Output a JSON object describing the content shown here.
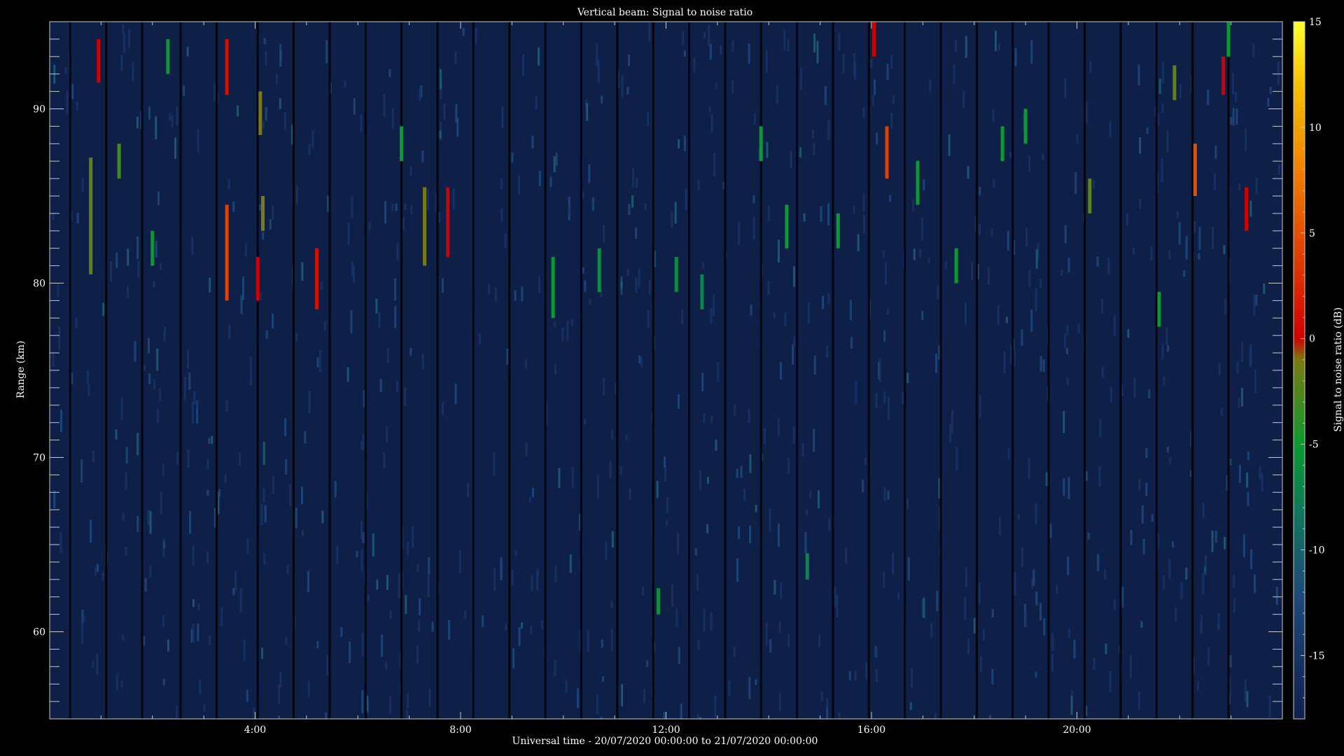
{
  "chart_data": {
    "type": "heatmap",
    "title": "Vertical beam: Signal to noise ratio",
    "xlabel": "Universal time - 20/07/2020 00:00:00 to 21/07/2020 00:00:00",
    "ylabel": "Range (km)",
    "colorbar_label": "Signal to noise ratio (dB)",
    "x_range_hours": [
      0,
      24
    ],
    "y_range_km": [
      55,
      95
    ],
    "color_range_db": [
      -18,
      15
    ],
    "background_color": "#0e1f48",
    "x_ticks": [
      {
        "value": 4,
        "label": "4:00"
      },
      {
        "value": 8,
        "label": "8:00"
      },
      {
        "value": 12,
        "label": "12:00"
      },
      {
        "value": 16,
        "label": "16:00"
      },
      {
        "value": 20,
        "label": "20:00"
      }
    ],
    "y_ticks": [
      {
        "value": 60,
        "label": "60"
      },
      {
        "value": 70,
        "label": "70"
      },
      {
        "value": 80,
        "label": "80"
      },
      {
        "value": 90,
        "label": "90"
      }
    ],
    "colorbar_ticks": [
      {
        "value": 15,
        "label": "15"
      },
      {
        "value": 10,
        "label": "10"
      },
      {
        "value": 5,
        "label": "5"
      },
      {
        "value": 0,
        "label": "0"
      },
      {
        "value": -5,
        "label": "-5"
      },
      {
        "value": -10,
        "label": "-10"
      },
      {
        "value": -15,
        "label": "-15"
      }
    ],
    "colormap": [
      {
        "db": -18,
        "color": "#10204e"
      },
      {
        "db": -12,
        "color": "#1e4a78"
      },
      {
        "db": -8,
        "color": "#0f7a5a"
      },
      {
        "db": -5,
        "color": "#0a9a30"
      },
      {
        "db": -1,
        "color": "#7a7a10"
      },
      {
        "db": 0,
        "color": "#d00000"
      },
      {
        "db": 4,
        "color": "#e04000"
      },
      {
        "db": 8,
        "color": "#f08000"
      },
      {
        "db": 12,
        "color": "#f8c000"
      },
      {
        "db": 15,
        "color": "#ffff30"
      }
    ],
    "data_gap_times_hours": [
      0.4,
      1.1,
      1.8,
      2.55,
      3.25,
      4.05,
      4.75,
      5.45,
      6.15,
      6.85,
      7.55,
      8.25,
      8.95,
      9.65,
      10.35,
      11.05,
      11.75,
      12.45,
      13.15,
      13.85,
      14.55,
      15.25,
      15.95,
      16.65,
      17.35,
      18.05,
      18.75,
      19.45,
      20.15,
      20.85,
      21.55,
      22.25,
      22.95
    ],
    "echoes": [
      {
        "t": 0.8,
        "r0": 80.5,
        "r1": 87.2,
        "db": -2
      },
      {
        "t": 0.95,
        "r0": 91.5,
        "r1": 94.0,
        "db": 0
      },
      {
        "t": 1.35,
        "r0": 86.0,
        "r1": 88.0,
        "db": -3
      },
      {
        "t": 2.0,
        "r0": 81.0,
        "r1": 83.0,
        "db": -5
      },
      {
        "t": 2.3,
        "r0": 92.0,
        "r1": 94.0,
        "db": -5
      },
      {
        "t": 3.45,
        "r0": 79.0,
        "r1": 84.5,
        "db": 4
      },
      {
        "t": 3.45,
        "r0": 90.8,
        "r1": 94.0,
        "db": 1
      },
      {
        "t": 4.05,
        "r0": 79.0,
        "r1": 81.5,
        "db": 0
      },
      {
        "t": 4.1,
        "r0": 88.5,
        "r1": 91.0,
        "db": -1
      },
      {
        "t": 4.15,
        "r0": 83.0,
        "r1": 85.0,
        "db": -1
      },
      {
        "t": 5.2,
        "r0": 78.5,
        "r1": 82.0,
        "db": 1
      },
      {
        "t": 6.85,
        "r0": 87.0,
        "r1": 89.0,
        "db": -5
      },
      {
        "t": 7.3,
        "r0": 81.0,
        "r1": 85.5,
        "db": -1
      },
      {
        "t": 7.75,
        "r0": 81.5,
        "r1": 85.5,
        "db": 0
      },
      {
        "t": 9.8,
        "r0": 78.0,
        "r1": 81.5,
        "db": -5
      },
      {
        "t": 10.7,
        "r0": 79.5,
        "r1": 82.0,
        "db": -6
      },
      {
        "t": 12.2,
        "r0": 79.5,
        "r1": 81.5,
        "db": -6
      },
      {
        "t": 12.7,
        "r0": 78.5,
        "r1": 80.5,
        "db": -7
      },
      {
        "t": 11.85,
        "r0": 61.0,
        "r1": 62.5,
        "db": -6
      },
      {
        "t": 13.85,
        "r0": 87.0,
        "r1": 89.0,
        "db": -5
      },
      {
        "t": 14.35,
        "r0": 82.0,
        "r1": 84.5,
        "db": -5
      },
      {
        "t": 14.75,
        "r0": 63.0,
        "r1": 64.5,
        "db": -7
      },
      {
        "t": 15.35,
        "r0": 82.0,
        "r1": 84.0,
        "db": -5
      },
      {
        "t": 16.05,
        "r0": 93.0,
        "r1": 95.0,
        "db": 0
      },
      {
        "t": 16.3,
        "r0": 86.0,
        "r1": 89.0,
        "db": 4
      },
      {
        "t": 16.9,
        "r0": 84.5,
        "r1": 87.0,
        "db": -5
      },
      {
        "t": 17.65,
        "r0": 80.0,
        "r1": 82.0,
        "db": -5
      },
      {
        "t": 18.55,
        "r0": 87.0,
        "r1": 89.0,
        "db": -5
      },
      {
        "t": 19.0,
        "r0": 88.0,
        "r1": 90.0,
        "db": -5
      },
      {
        "t": 20.25,
        "r0": 84.0,
        "r1": 86.0,
        "db": -2
      },
      {
        "t": 21.6,
        "r0": 77.5,
        "r1": 79.5,
        "db": -5
      },
      {
        "t": 21.9,
        "r0": 90.5,
        "r1": 92.5,
        "db": -2
      },
      {
        "t": 22.3,
        "r0": 85.0,
        "r1": 88.0,
        "db": 5
      },
      {
        "t": 22.85,
        "r0": 90.8,
        "r1": 93.0,
        "db": 0
      },
      {
        "t": 22.95,
        "r0": 93.0,
        "r1": 95.0,
        "db": -5
      },
      {
        "t": 23.3,
        "r0": 83.0,
        "r1": 85.5,
        "db": 0
      }
    ]
  }
}
